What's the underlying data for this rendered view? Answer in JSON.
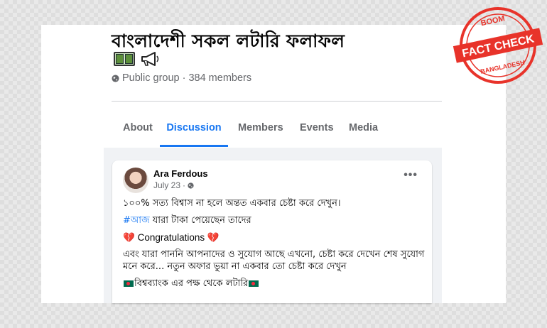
{
  "group": {
    "title": "বাংলাদেশী সকল লটারি ফলাফল",
    "title_icons": [
      "money-icon",
      "megaphone-icon"
    ],
    "privacy": "Public group",
    "separator": "·",
    "members": "384 members"
  },
  "tabs": [
    {
      "label": "About",
      "active": false
    },
    {
      "label": "Discussion",
      "active": true
    },
    {
      "label": "Members",
      "active": false
    },
    {
      "label": "Events",
      "active": false
    },
    {
      "label": "Media",
      "active": false
    }
  ],
  "post": {
    "author": "Ara Ferdous",
    "date": "July 23",
    "separator": "·",
    "more": "•••",
    "line1": "১০০% সত্য বিশ্বাস না হলে অন্তত একবার চেষ্টা করে দেখুন।",
    "hashtag": "#আজ",
    "line2_rest": " যারা টাকা পেয়েছেন তাদের",
    "heart": "💔",
    "congrats": "Congratulations",
    "line4": "এবং যারা পাননি আপনাদের ও সুযোগ আছে এখনো, চেষ্টা করে দেখেন শেষ সুযোগ মনে করে... নতুন অফার ভুয়া না একবার তো চেষ্টা করে দেখুন",
    "line5": "বিশ্বব্যাংক এর পক্ষ থেকে লটারি"
  },
  "stamp": {
    "top": "BOOM",
    "main": "FACT CHECK",
    "bottom": "BANGLADESH",
    "color": "#e8332a"
  },
  "colors": {
    "accent": "#1877f2",
    "text_secondary": "#65676b",
    "feed_bg": "#f0f2f5"
  }
}
